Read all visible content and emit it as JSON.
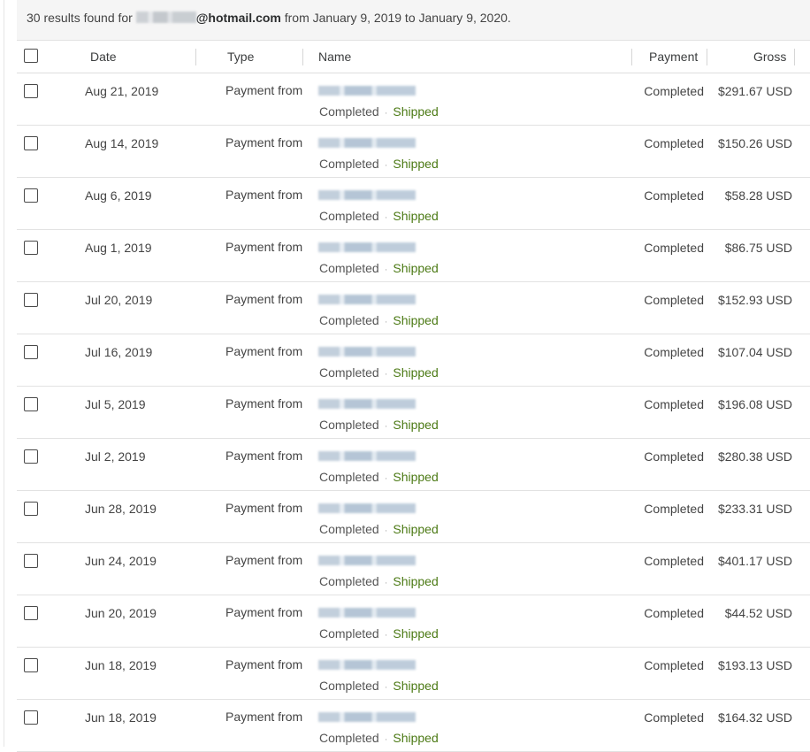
{
  "summary": {
    "count_text": "30 results found for",
    "email_domain": "@hotmail.com",
    "range_text": "from January 9, 2019 to January 9, 2020."
  },
  "columns": {
    "date": "Date",
    "type": "Type",
    "name": "Name",
    "payment": "Payment",
    "gross": "Gross"
  },
  "rows": [
    {
      "date": "Aug 21, 2019",
      "type": "Payment from",
      "status": "Completed",
      "shipping": "Shipped",
      "payment": "Completed",
      "gross": "$291.67 USD"
    },
    {
      "date": "Aug 14, 2019",
      "type": "Payment from",
      "status": "Completed",
      "shipping": "Shipped",
      "payment": "Completed",
      "gross": "$150.26 USD"
    },
    {
      "date": "Aug 6, 2019",
      "type": "Payment from",
      "status": "Completed",
      "shipping": "Shipped",
      "payment": "Completed",
      "gross": "$58.28 USD"
    },
    {
      "date": "Aug 1, 2019",
      "type": "Payment from",
      "status": "Completed",
      "shipping": "Shipped",
      "payment": "Completed",
      "gross": "$86.75 USD"
    },
    {
      "date": "Jul 20, 2019",
      "type": "Payment from",
      "status": "Completed",
      "shipping": "Shipped",
      "payment": "Completed",
      "gross": "$152.93 USD"
    },
    {
      "date": "Jul 16, 2019",
      "type": "Payment from",
      "status": "Completed",
      "shipping": "Shipped",
      "payment": "Completed",
      "gross": "$107.04 USD"
    },
    {
      "date": "Jul 5, 2019",
      "type": "Payment from",
      "status": "Completed",
      "shipping": "Shipped",
      "payment": "Completed",
      "gross": "$196.08 USD"
    },
    {
      "date": "Jul 2, 2019",
      "type": "Payment from",
      "status": "Completed",
      "shipping": "Shipped",
      "payment": "Completed",
      "gross": "$280.38 USD"
    },
    {
      "date": "Jun 28, 2019",
      "type": "Payment from",
      "status": "Completed",
      "shipping": "Shipped",
      "payment": "Completed",
      "gross": "$233.31 USD"
    },
    {
      "date": "Jun 24, 2019",
      "type": "Payment from",
      "status": "Completed",
      "shipping": "Shipped",
      "payment": "Completed",
      "gross": "$401.17 USD"
    },
    {
      "date": "Jun 20, 2019",
      "type": "Payment from",
      "status": "Completed",
      "shipping": "Shipped",
      "payment": "Completed",
      "gross": "$44.52 USD"
    },
    {
      "date": "Jun 18, 2019",
      "type": "Payment from",
      "status": "Completed",
      "shipping": "Shipped",
      "payment": "Completed",
      "gross": "$193.13 USD"
    },
    {
      "date": "Jun 18, 2019",
      "type": "Payment from",
      "status": "Completed",
      "shipping": "Shipped",
      "payment": "Completed",
      "gross": "$164.32 USD"
    }
  ],
  "colors": {
    "shipped": "#4c7a15",
    "summary_bg": "#f5f5f5",
    "row_border": "#e2e2e2"
  }
}
